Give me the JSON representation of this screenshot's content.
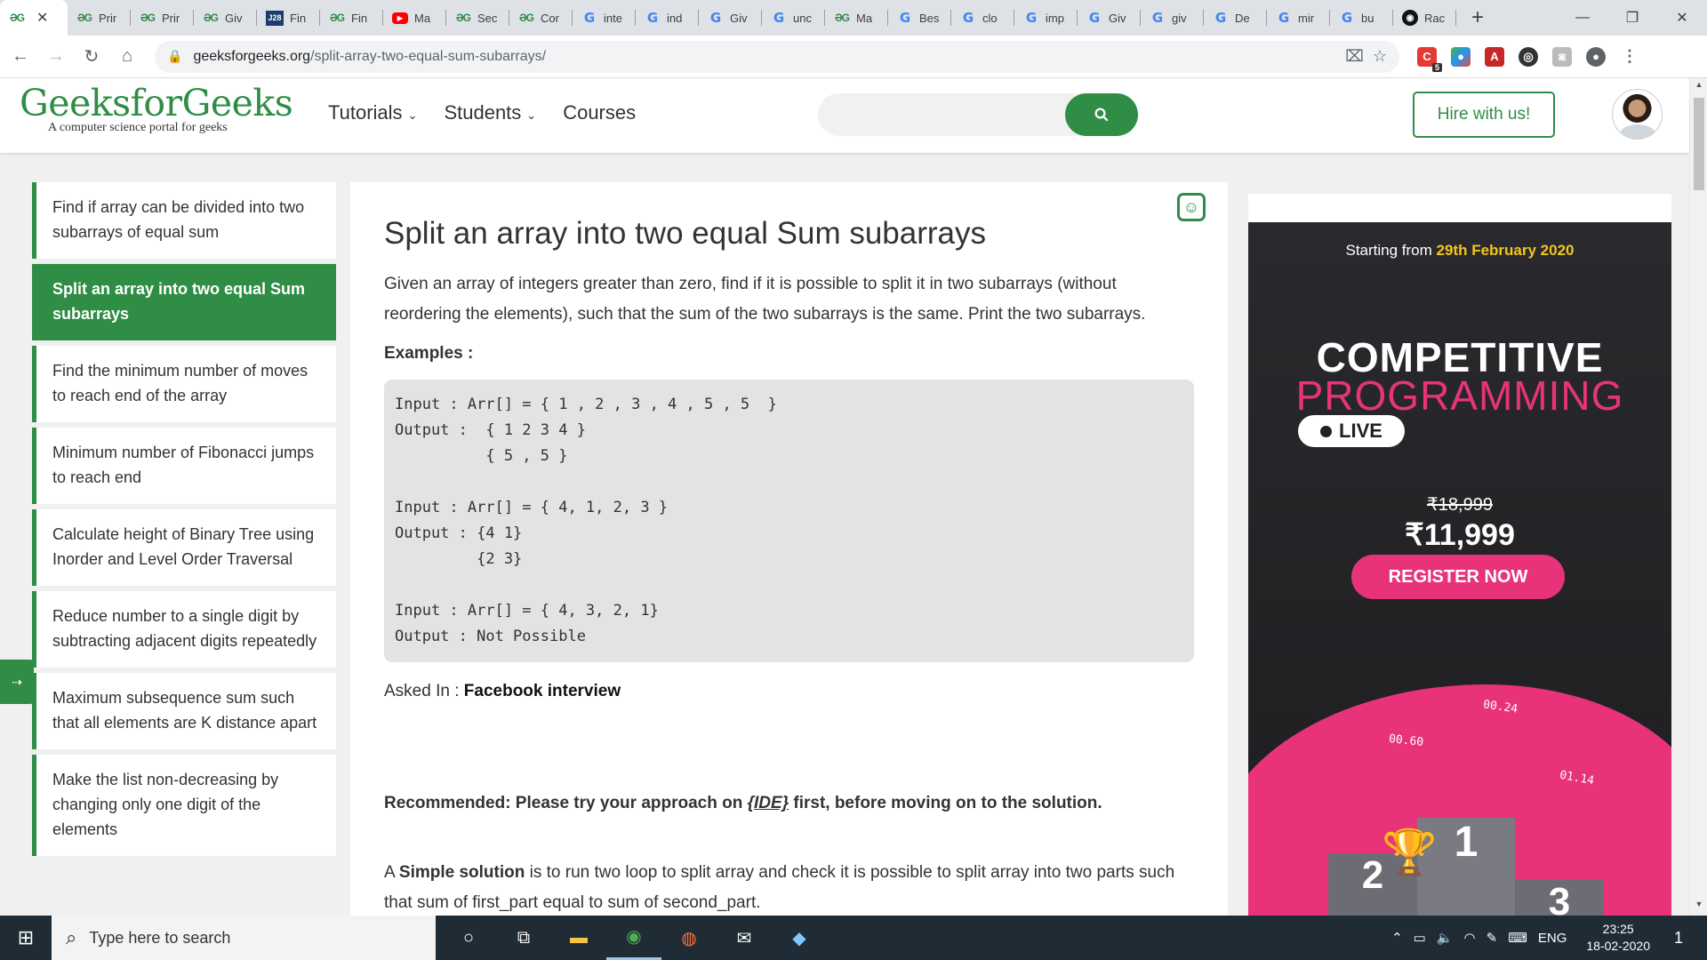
{
  "browser": {
    "tabs": [
      {
        "label": "",
        "icon": "gfg",
        "active": true
      },
      {
        "label": "Prir",
        "icon": "gfg"
      },
      {
        "label": "Prir",
        "icon": "gfg"
      },
      {
        "label": "Giv",
        "icon": "gfg"
      },
      {
        "label": "Fin",
        "icon": "j28"
      },
      {
        "label": "Fin",
        "icon": "gfg"
      },
      {
        "label": "Ma",
        "icon": "youtube"
      },
      {
        "label": "Sec",
        "icon": "gfg"
      },
      {
        "label": "Cor",
        "icon": "gfg"
      },
      {
        "label": "inte",
        "icon": "google"
      },
      {
        "label": "ind",
        "icon": "google"
      },
      {
        "label": "Giv",
        "icon": "google"
      },
      {
        "label": "unc",
        "icon": "google"
      },
      {
        "label": "Ma",
        "icon": "gfg"
      },
      {
        "label": "Bes",
        "icon": "google"
      },
      {
        "label": "clo",
        "icon": "google"
      },
      {
        "label": "imp",
        "icon": "google"
      },
      {
        "label": "Giv",
        "icon": "google"
      },
      {
        "label": "giv",
        "icon": "google"
      },
      {
        "label": "De",
        "icon": "google"
      },
      {
        "label": "mir",
        "icon": "google"
      },
      {
        "label": "bu",
        "icon": "google"
      },
      {
        "label": "Rac",
        "icon": "github"
      }
    ],
    "url_host": "geeksforgeeks.org",
    "url_path": "/split-array-two-equal-sum-subarrays/",
    "extension_badge": "5"
  },
  "site": {
    "logo": "GeeksforGeeks",
    "tagline": "A computer science portal for geeks",
    "nav": [
      "Tutorials",
      "Students",
      "Courses"
    ],
    "search_placeholder": "",
    "hire_button": "Hire with us!",
    "brand_color": "#2f8d46"
  },
  "sidebar": {
    "items": [
      {
        "label": "Find if array can be divided into two subarrays of equal sum"
      },
      {
        "label": "Split an array into two equal Sum subarrays",
        "active": true
      },
      {
        "label": "Find the minimum number of moves to reach end of the array"
      },
      {
        "label": "Minimum number of Fibonacci jumps to reach end"
      },
      {
        "label": "Calculate height of Binary Tree using Inorder and Level Order Traversal"
      },
      {
        "label": "Reduce number to a single digit by subtracting adjacent digits repeatedly"
      },
      {
        "label": "Maximum subsequence sum such that all elements are K distance apart"
      },
      {
        "label": "Make the list non-decreasing by changing only one digit of the elements"
      }
    ]
  },
  "article": {
    "title": "Split an array into two equal Sum subarrays",
    "intro": "Given an array of integers greater than zero, find if it is possible to split it in two subarrays (without reordering the elements), such that the sum of the two subarrays is the same. Print the two subarrays.",
    "examples_label": "Examples :",
    "code": "Input : Arr[] = { 1 , 2 , 3 , 4 , 5 , 5  }\nOutput :  { 1 2 3 4 }\n          { 5 , 5 }\n\nInput : Arr[] = { 4, 1, 2, 3 }\nOutput : {4 1}\n         {2 3}\n\nInput : Arr[] = { 4, 3, 2, 1}\nOutput : Not Possible",
    "asked_in_label": "Asked In : ",
    "asked_in_value": "Facebook interview",
    "recommend_pre": "Recommended: Please try your approach on ",
    "recommend_link": "{IDE}",
    "recommend_post": " first, before moving on to the solution.",
    "simple_pre": "A ",
    "simple_bold": "Simple solution",
    "simple_post": " is to run two loop to split array and check it is possible to split array into two parts such that sum of first_part equal to sum of second_part."
  },
  "ad": {
    "starting_pre": "Starting from ",
    "starting_date": "29th February 2020",
    "title_line1": "COMPETITIVE",
    "title_line2": "PROGRAMMING",
    "live": "LIVE",
    "old_price": "₹18,999",
    "new_price": "₹11,999",
    "register": "REGISTER NOW",
    "timers": [
      "00.24",
      "00.60",
      "01.14"
    ],
    "podium": [
      "2",
      "1",
      "3"
    ],
    "accent_color": "#e8337a"
  },
  "taskbar": {
    "search_placeholder": "Type here to search",
    "language": "ENG",
    "time": "23:25",
    "date": "18-02-2020",
    "notifications": "1"
  }
}
